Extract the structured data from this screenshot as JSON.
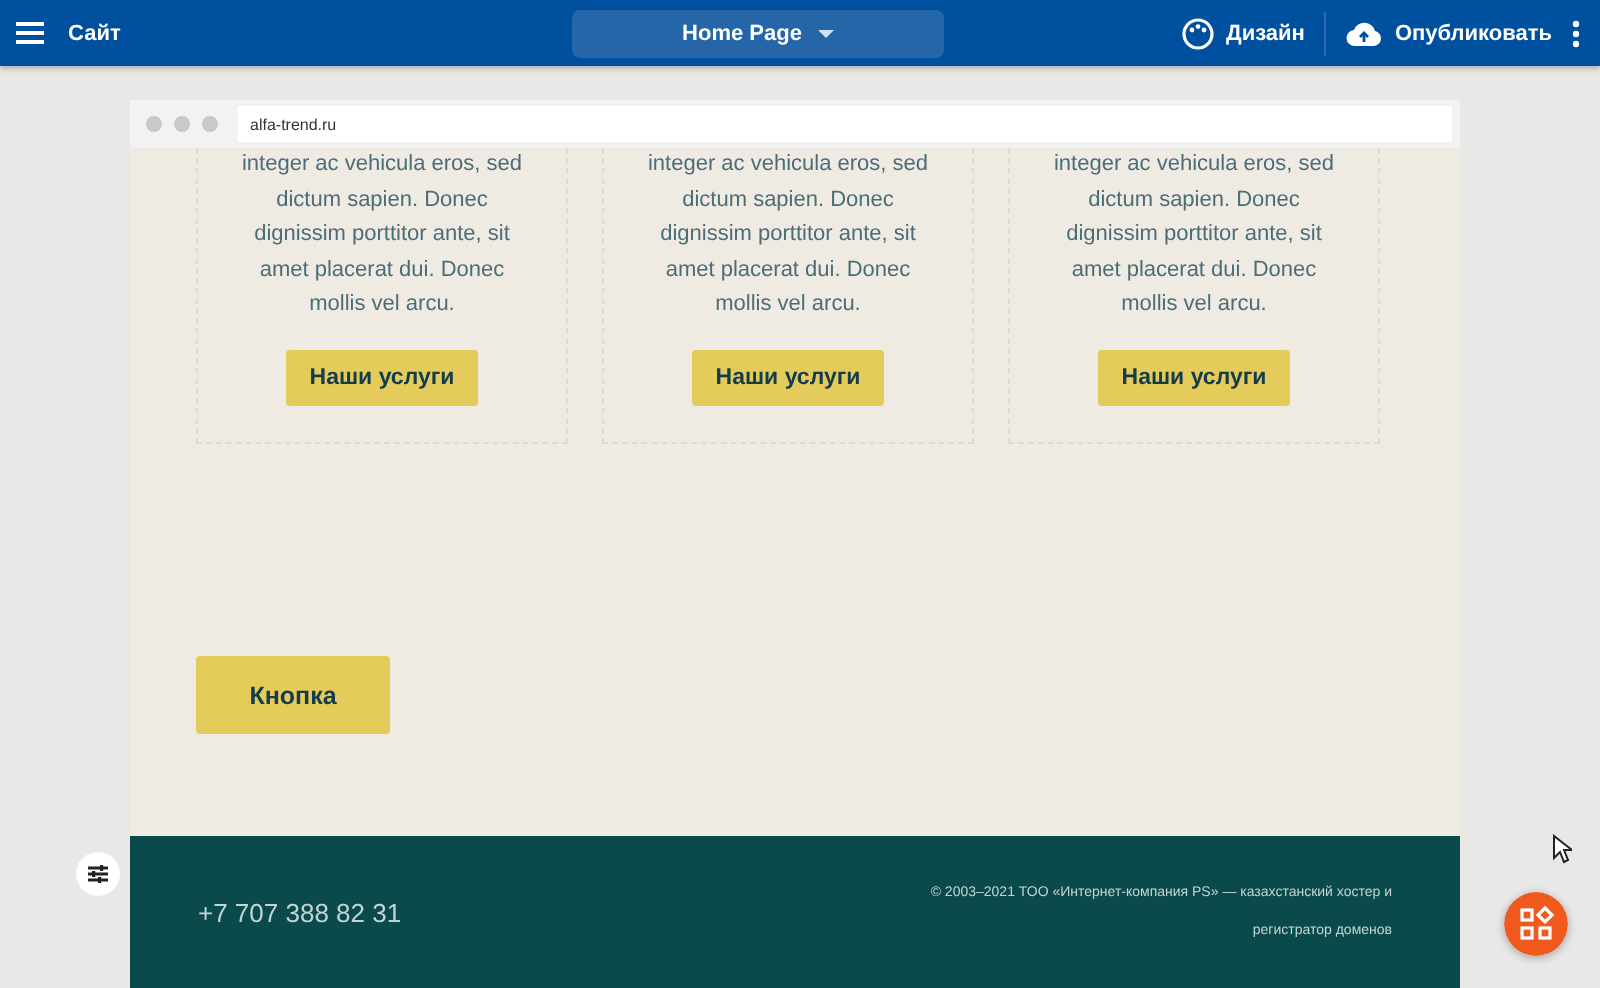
{
  "topbar": {
    "site_label": "Сайт",
    "page_selector": "Home Page",
    "design_label": "Дизайн",
    "publish_label": "Опубликовать"
  },
  "browser": {
    "address": "alfa-trend.ru"
  },
  "cards": [
    {
      "text": "integer ac vehicula eros, sed dictum sapien. Donec dignissim porttitor ante, sit amet placerat dui. Donec mollis vel arcu.",
      "button": "Наши услуги"
    },
    {
      "text": "integer ac vehicula eros, sed dictum sapien. Donec dignissim porttitor ante, sit amet placerat dui. Donec mollis vel arcu.",
      "button": "Наши услуги"
    },
    {
      "text": "integer ac vehicula eros, sed dictum sapien. Donec dignissim porttitor ante, sit amet placerat dui. Donec mollis vel arcu.",
      "button": "Наши услуги"
    }
  ],
  "main_button": "Кнопка",
  "footer": {
    "phone": "+7 707 388 82 31",
    "copyright": "© 2003–2021 ТОО «Интернет-компания PS» — казахстанский хостер и регистратор доменов"
  }
}
